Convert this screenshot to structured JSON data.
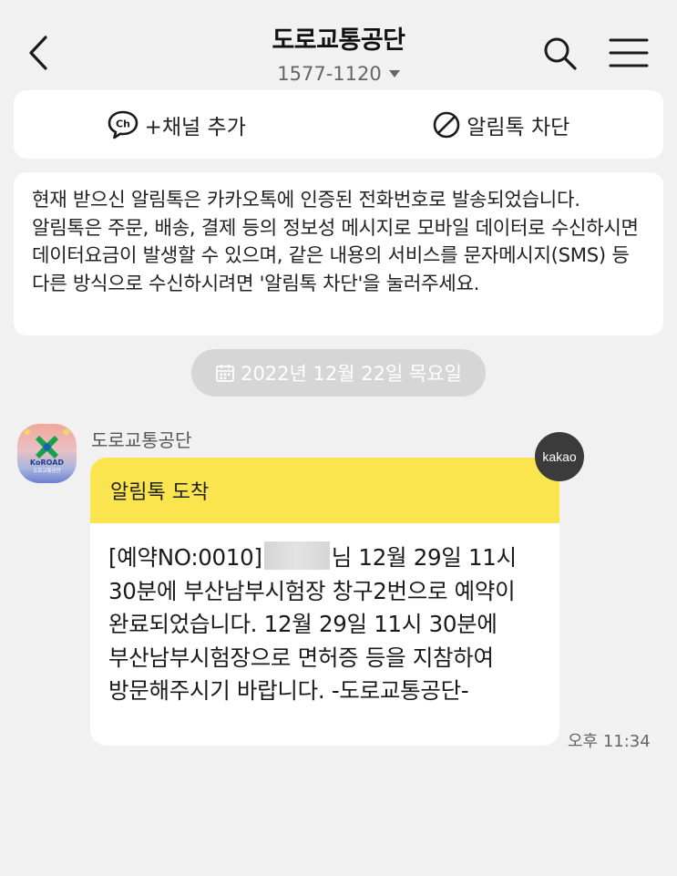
{
  "header": {
    "title": "도로교통공단",
    "phone": "1577-1120"
  },
  "actions": {
    "add_channel": "+채널 추가",
    "block": "알림톡 차단"
  },
  "notice": {
    "text": "현재 받으신 알림톡은 카카오톡에 인증된 전화번호로 발송되었습니다. 알림톡은 주문, 배송, 결제 등의 정보성 메시지로 모바일 데이터로 수신하시면 데이터요금이 발생할 수 있으며, 같은 내용의 서비스를 문자메시지(SMS) 등 다른 방식으로 수신하시려면 '알림톡 차단'을 눌러주세요."
  },
  "date_divider": "2022년 12월 22일 목요일",
  "message": {
    "sender": "도로교통공단",
    "avatar_text": "KoROAD",
    "avatar_sub": "도로교통공단",
    "badge": "kakao",
    "header": "알림톡 도착",
    "body_prefix": "[예약NO:0010]",
    "body_rest": "님 12월 29일 11시 30분에 부산남부시험장 창구2번으로 예약이 완료되었습니다. 12월 29일 11시 30분에 부산남부시험장으로 면허증 등을 지참하여 방문해주시기 바랍니다. -도로교통공단-",
    "time": "오후 11:34"
  },
  "colors": {
    "background": "#f1f1f1",
    "bubble_header": "#fae54f",
    "date_pill": "#d6d6d6",
    "badge": "#3b3b3b"
  }
}
